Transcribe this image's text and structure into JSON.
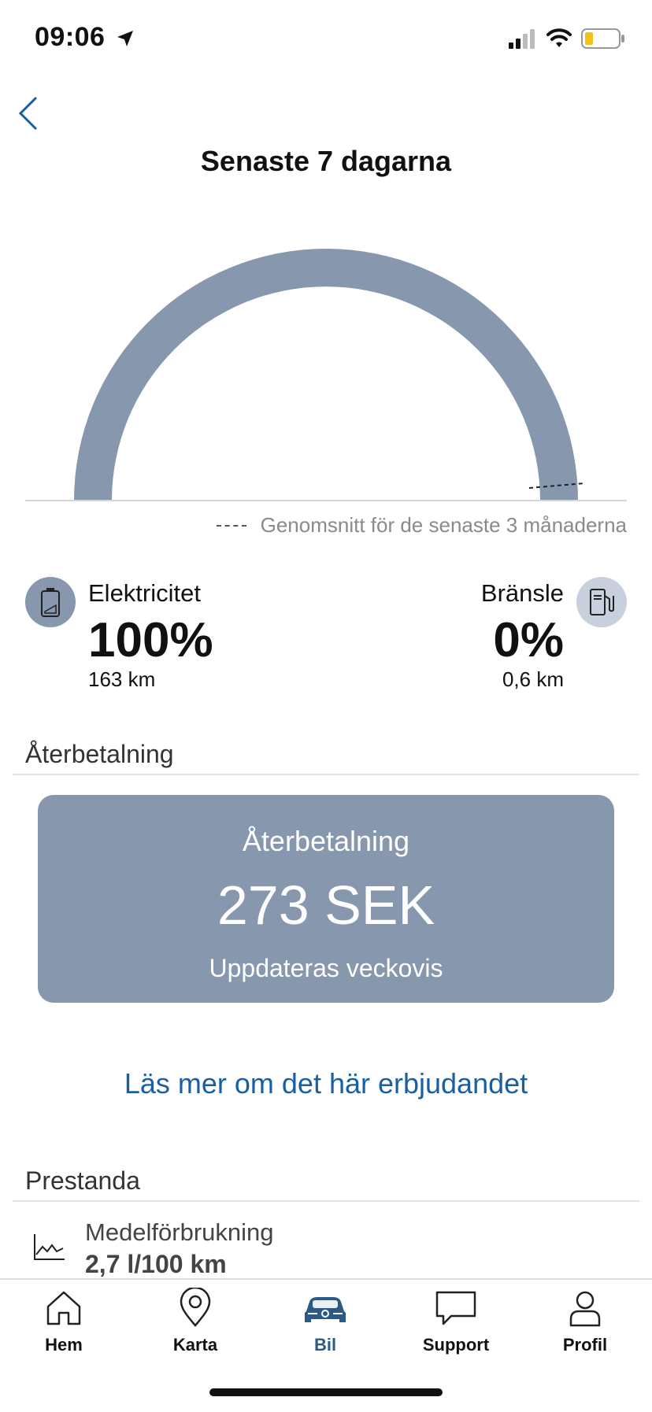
{
  "status_bar": {
    "time": "09:06"
  },
  "header": {
    "title": "Senaste 7 dagarna"
  },
  "gauge": {
    "legend": "Genomsnitt för de senaste 3 månaderna",
    "color": "#8697ae",
    "fill_fraction": 1.0
  },
  "energy": {
    "electricity": {
      "label": "Elektricitet",
      "percent": "100%",
      "range": "163 km"
    },
    "fuel": {
      "label": "Bränsle",
      "percent": "0%",
      "range": "0,6 km"
    }
  },
  "refund": {
    "section_title": "Återbetalning",
    "card_title": "Återbetalning",
    "amount": "273 SEK",
    "subtitle": "Uppdateras veckovis",
    "link": "Läs mer om det här erbjudandet"
  },
  "performance": {
    "section_title": "Prestanda",
    "items": [
      {
        "label": "Medelförbrukning",
        "value": "2,7 l/100 km"
      }
    ]
  },
  "tabs": [
    {
      "label": "Hem",
      "icon": "home-icon",
      "active": false
    },
    {
      "label": "Karta",
      "icon": "map-pin-icon",
      "active": false
    },
    {
      "label": "Bil",
      "icon": "car-icon",
      "active": true
    },
    {
      "label": "Support",
      "icon": "chat-bubble-icon",
      "active": false
    },
    {
      "label": "Profil",
      "icon": "user-icon",
      "active": false
    }
  ],
  "colors": {
    "accent": "#1b5fa3",
    "card": "#8697ae",
    "active_tab": "#2b5a86"
  }
}
